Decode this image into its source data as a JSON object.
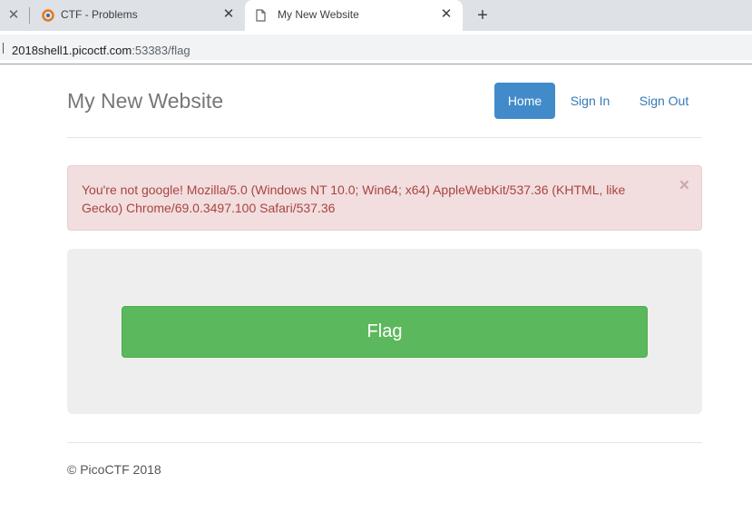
{
  "browser": {
    "tabs": [
      {
        "title": "CTF - Problems",
        "favicon": "picoctf-logo-icon",
        "active": false
      },
      {
        "title": "My New Website",
        "favicon": "page-icon",
        "active": true
      }
    ],
    "close_glyph": "✕",
    "new_tab_glyph": "+",
    "address": {
      "host": "2018shell1.picoctf.com",
      "rest": ":53383/flag"
    }
  },
  "site": {
    "title": "My New Website",
    "nav": {
      "home": "Home",
      "sign_in": "Sign In",
      "sign_out": "Sign Out"
    },
    "alert": {
      "message": "You're not google! Mozilla/5.0 (Windows NT 10.0; Win64; x64) AppleWebKit/537.36 (KHTML, like Gecko) Chrome/69.0.3497.100 Safari/537.36",
      "close_glyph": "×"
    },
    "flag_button": "Flag",
    "footer": "© PicoCTF 2018"
  },
  "colors": {
    "primary": "#428bca",
    "success": "#5cb85c",
    "danger_bg": "#f2dede",
    "danger_text": "#a94442"
  }
}
